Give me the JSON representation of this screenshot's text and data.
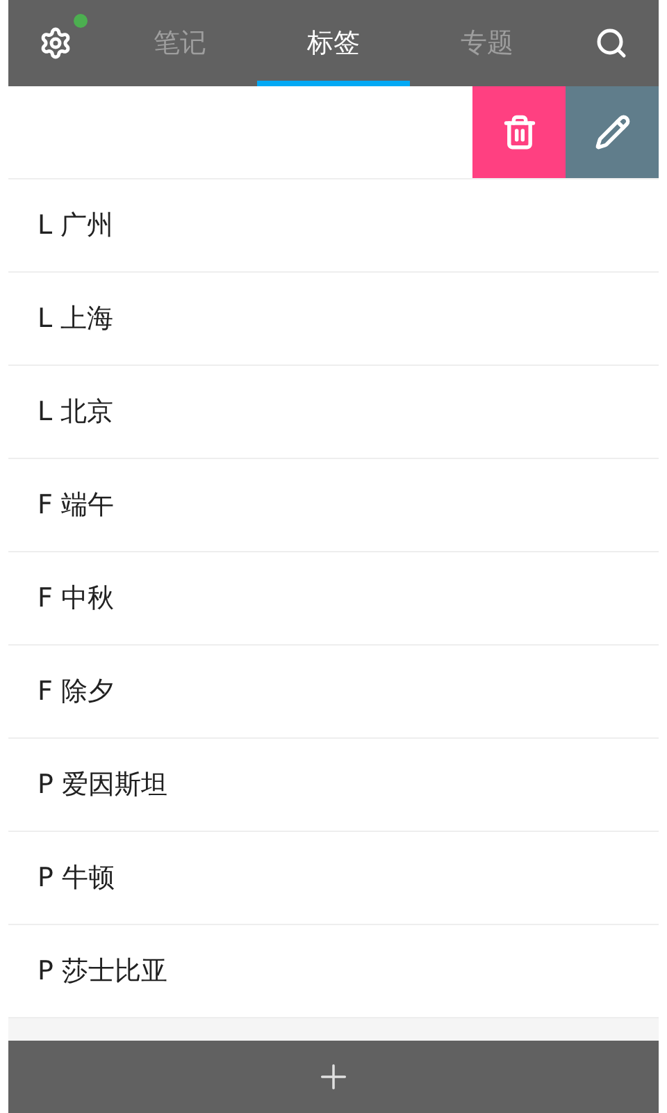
{
  "header": {
    "notification_dot": {
      "color": "#4caf50"
    },
    "tabs": [
      {
        "label": "笔记",
        "selected": false
      },
      {
        "label": "标签",
        "selected": true
      },
      {
        "label": "专题",
        "selected": false
      }
    ]
  },
  "swiped_row": {
    "actions": [
      {
        "kind": "delete"
      },
      {
        "kind": "edit"
      }
    ]
  },
  "tags": [
    {
      "label": "L 广州"
    },
    {
      "label": "L 上海"
    },
    {
      "label": "L 北京"
    },
    {
      "label": "F 端午"
    },
    {
      "label": "F 中秋"
    },
    {
      "label": "F 除夕"
    },
    {
      "label": "P 爱因斯坦"
    },
    {
      "label": "P 牛顿"
    },
    {
      "label": "P 莎士比亚"
    }
  ]
}
